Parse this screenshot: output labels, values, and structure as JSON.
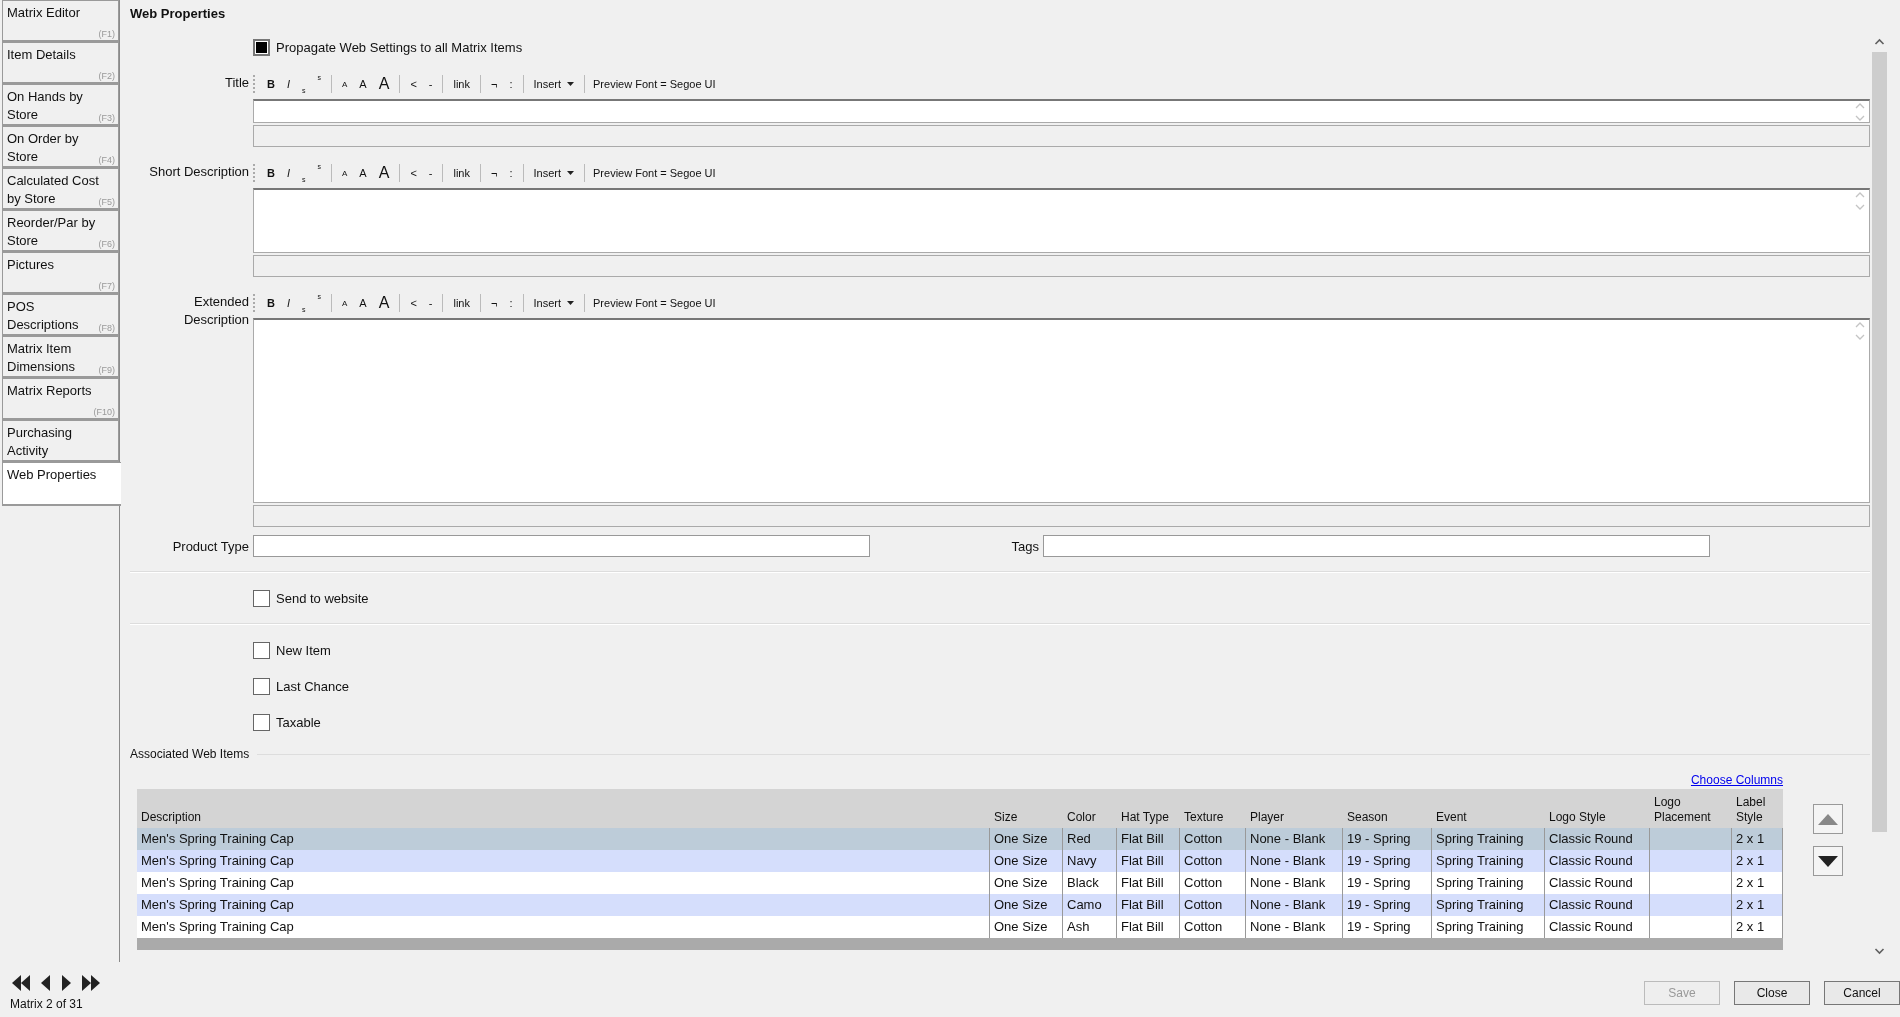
{
  "sidebar": {
    "tabs": [
      {
        "label": "Matrix Editor",
        "key": "(F1)",
        "selected": false
      },
      {
        "label": "Item Details",
        "key": "(F2)",
        "selected": false
      },
      {
        "label": "On Hands by Store",
        "key": "(F3)",
        "selected": false
      },
      {
        "label": "On Order by Store",
        "key": "(F4)",
        "selected": false
      },
      {
        "label": "Calculated Cost by Store",
        "key": "(F5)",
        "selected": false
      },
      {
        "label": "Reorder/Par by Store",
        "key": "(F6)",
        "selected": false
      },
      {
        "label": "Pictures",
        "key": "(F7)",
        "selected": false
      },
      {
        "label": "POS Descriptions",
        "key": "(F8)",
        "selected": false
      },
      {
        "label": "Matrix Item Dimensions",
        "key": "(F9)",
        "selected": false
      },
      {
        "label": "Matrix Reports",
        "key": "(F10)",
        "selected": false
      },
      {
        "label": "Purchasing Activity",
        "selected": false
      },
      {
        "label": "Web Properties",
        "selected": true
      }
    ]
  },
  "heading": "Web Properties",
  "propagate": {
    "label": "Propagate Web Settings to all Matrix Items",
    "checked": true
  },
  "editors": [
    {
      "label": "Title",
      "kind": "line",
      "toolbar": [
        [
          {
            "label": "B",
            "kind": "bold"
          },
          {
            "label": "I",
            "kind": "italic"
          },
          {
            "label": "s",
            "kind": "sub"
          },
          {
            "label": "s",
            "kind": "sup"
          }
        ],
        [
          {
            "label": "A",
            "kind": "small"
          },
          {
            "label": "A",
            "kind": "medium"
          },
          {
            "label": "A",
            "kind": "large"
          }
        ],
        [
          {
            "label": "<",
            "kind": "plain"
          },
          {
            "label": "-",
            "kind": "plain"
          }
        ],
        [
          {
            "label": "link",
            "kind": "plain"
          }
        ],
        [
          {
            "label": "¬",
            "kind": "plain"
          },
          {
            "label": ":",
            "kind": "plain"
          }
        ],
        [
          {
            "label": "Insert",
            "kind": "dropdown"
          }
        ],
        [
          {
            "label": "Preview Font = Segoe UI",
            "kind": "note"
          }
        ]
      ]
    },
    {
      "label": "Short Description",
      "kind": "short",
      "toolbar": [
        [
          {
            "label": "B",
            "kind": "bold"
          },
          {
            "label": "I",
            "kind": "italic"
          },
          {
            "label": "s",
            "kind": "sub"
          },
          {
            "label": "s",
            "kind": "sup"
          }
        ],
        [
          {
            "label": "A",
            "kind": "small"
          },
          {
            "label": "A",
            "kind": "medium"
          },
          {
            "label": "A",
            "kind": "large"
          }
        ],
        [
          {
            "label": "<",
            "kind": "plain"
          },
          {
            "label": "-",
            "kind": "plain"
          }
        ],
        [
          {
            "label": "link",
            "kind": "plain"
          }
        ],
        [
          {
            "label": "¬",
            "kind": "plain"
          },
          {
            "label": ":",
            "kind": "plain"
          }
        ],
        [
          {
            "label": "Insert",
            "kind": "dropdown"
          }
        ],
        [
          {
            "label": "Preview Font = Segoe UI",
            "kind": "note"
          }
        ]
      ]
    },
    {
      "label": "Extended Description",
      "kind": "long",
      "toolbar": [
        [
          {
            "label": "B",
            "kind": "bold"
          },
          {
            "label": "I",
            "kind": "italic"
          },
          {
            "label": "s",
            "kind": "sub"
          },
          {
            "label": "s",
            "kind": "sup"
          }
        ],
        [
          {
            "label": "A",
            "kind": "small"
          },
          {
            "label": "A",
            "kind": "medium"
          },
          {
            "label": "A",
            "kind": "large"
          }
        ],
        [
          {
            "label": "<",
            "kind": "plain"
          },
          {
            "label": "-",
            "kind": "plain"
          }
        ],
        [
          {
            "label": "link",
            "kind": "plain"
          }
        ],
        [
          {
            "label": "¬",
            "kind": "plain"
          },
          {
            "label": ":",
            "kind": "plain"
          }
        ],
        [
          {
            "label": "Insert",
            "kind": "dropdown"
          }
        ],
        [
          {
            "label": "Preview Font = Segoe UI",
            "kind": "note"
          }
        ]
      ]
    }
  ],
  "product_type": {
    "label": "Product Type"
  },
  "tags": {
    "label": "Tags"
  },
  "send_to_website": {
    "label": "Send to website",
    "checked": false
  },
  "flags": [
    {
      "label": "New Item",
      "checked": false
    },
    {
      "label": "Last Chance",
      "checked": false
    },
    {
      "label": "Taxable",
      "checked": false
    }
  ],
  "associated": {
    "title": "Associated Web Items",
    "choose_columns": "Choose Columns",
    "columns": [
      "Description",
      "Size",
      "Color",
      "Hat Type",
      "Texture",
      "Player",
      "Season",
      "Event",
      "Logo Style",
      "Logo Placement",
      "Label Style"
    ],
    "rows": [
      {
        "selected": true,
        "cells": [
          "Men's Spring Training Cap",
          "One Size",
          "Red",
          "Flat Bill",
          "Cotton",
          "None - Blank",
          "19 - Spring",
          "Spring Training",
          "Classic Round",
          "",
          "2 x 1"
        ]
      },
      {
        "selected": false,
        "cells": [
          "Men's Spring Training Cap",
          "One Size",
          "Navy",
          "Flat Bill",
          "Cotton",
          "None - Blank",
          "19 - Spring",
          "Spring Training",
          "Classic Round",
          "",
          "2 x 1"
        ]
      },
      {
        "selected": false,
        "cells": [
          "Men's Spring Training Cap",
          "One Size",
          "Black",
          "Flat Bill",
          "Cotton",
          "None - Blank",
          "19 - Spring",
          "Spring Training",
          "Classic Round",
          "",
          "2 x 1"
        ]
      },
      {
        "selected": false,
        "cells": [
          "Men's Spring Training Cap",
          "One Size",
          "Camo",
          "Flat Bill",
          "Cotton",
          "None - Blank",
          "19 - Spring",
          "Spring Training",
          "Classic Round",
          "",
          "2 x 1"
        ]
      },
      {
        "selected": false,
        "cells": [
          "Men's Spring Training Cap",
          "One Size",
          "Ash",
          "Flat Bill",
          "Cotton",
          "None - Blank",
          "19 - Spring",
          "Spring Training",
          "Classic Round",
          "",
          "2 x 1"
        ]
      }
    ]
  },
  "navigator": {
    "position": "Matrix 2 of 31"
  },
  "buttons": [
    {
      "label": "Save",
      "disabled": true
    },
    {
      "label": "Close",
      "disabled": false
    },
    {
      "label": "Cancel",
      "disabled": false
    }
  ]
}
